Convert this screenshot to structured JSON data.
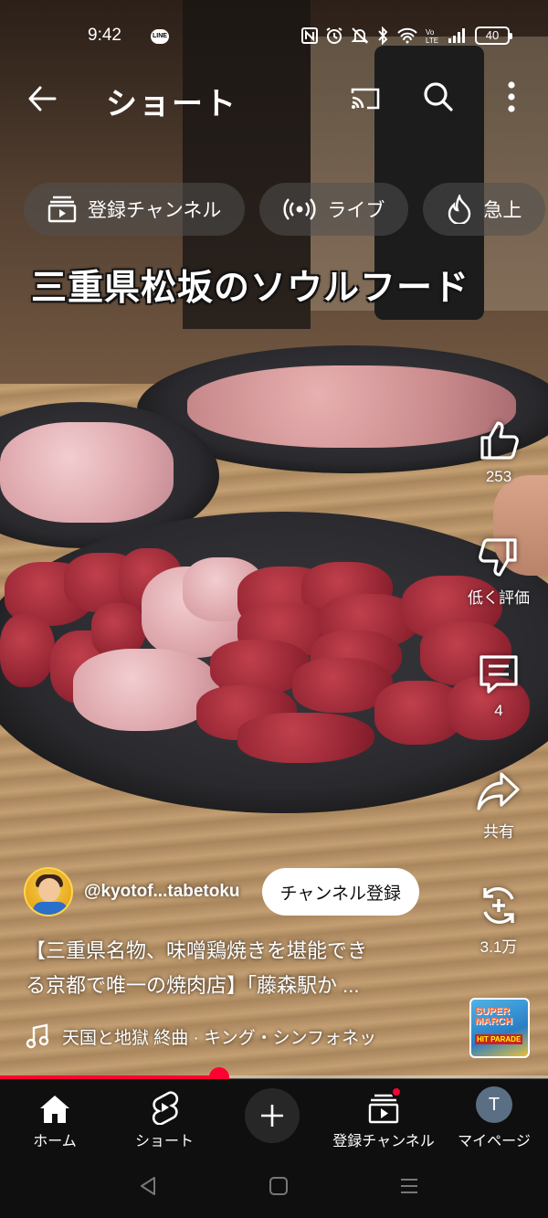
{
  "status_bar": {
    "time": "9:42",
    "battery": "40",
    "app_badge": "LINE"
  },
  "top_bar": {
    "title": "ショート"
  },
  "chips": [
    {
      "label": "登録チャンネル",
      "icon": "subscriptions-icon"
    },
    {
      "label": "ライブ",
      "icon": "live-icon"
    },
    {
      "label": "急上",
      "icon": "trending-icon"
    }
  ],
  "caption": "三重県松坂のソウルフード",
  "actions": {
    "like": "253",
    "dislike": "低く評価",
    "comments": "4",
    "share": "共有",
    "remix": "3.1万"
  },
  "channel": {
    "handle": "@kyotof...tabetoku",
    "subscribe_label": "チャンネル登録"
  },
  "video_title": {
    "line1": "【三重県名物、味噌鶏焼きを堪能でき",
    "line2": "る京都で唯一の焼肉店】「藤森駅か ..."
  },
  "music": "天国と地獄 終曲 · キング・シンフォネッ",
  "album_art": {
    "line1": "SUPER MARCH",
    "line2": "HIT PARADE"
  },
  "progress": 0.4,
  "bottom_nav": {
    "home": "ホーム",
    "shorts": "ショート",
    "subscriptions": "登録チャンネル",
    "you": "マイページ",
    "avatar_initial": "T"
  },
  "colors": {
    "accent": "#ff0033",
    "nav_bg": "#0f0f0f",
    "chip_bg": "#505050"
  }
}
